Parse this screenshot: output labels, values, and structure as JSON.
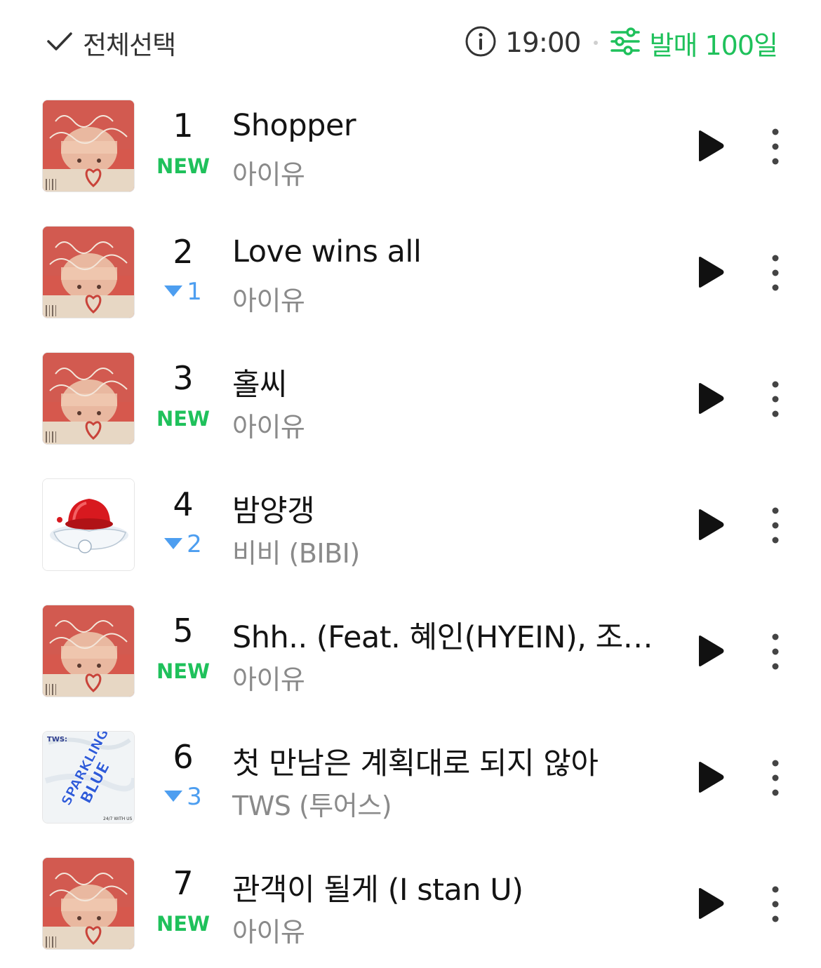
{
  "header": {
    "select_all_label": "전체선택",
    "time": "19:00",
    "filter_label": "발매 100일",
    "accent_color": "#1fc15b"
  },
  "songs": [
    {
      "rank": "1",
      "change": "NEW",
      "change_type": "new",
      "title": "Shopper",
      "artist": "아이유",
      "art": "the-winning"
    },
    {
      "rank": "2",
      "change": "1",
      "change_type": "down",
      "title": "Love wins all",
      "artist": "아이유",
      "art": "the-winning"
    },
    {
      "rank": "3",
      "change": "NEW",
      "change_type": "new",
      "title": "홀씨",
      "artist": "아이유",
      "art": "the-winning"
    },
    {
      "rank": "4",
      "change": "2",
      "change_type": "down",
      "title": "밤양갱",
      "artist": "비비 (BIBI)",
      "art": "jelly"
    },
    {
      "rank": "5",
      "change": "NEW",
      "change_type": "new",
      "title": "Shh.. (Feat. 혜인(HYEIN), 조원…",
      "artist": "아이유",
      "art": "the-winning"
    },
    {
      "rank": "6",
      "change": "3",
      "change_type": "down",
      "title": "첫 만남은 계획대로 되지 않아",
      "artist": "TWS (투어스)",
      "art": "sparkling-blue"
    },
    {
      "rank": "7",
      "change": "NEW",
      "change_type": "new",
      "title": "관객이 될게 (I stan U)",
      "artist": "아이유",
      "art": "the-winning"
    }
  ]
}
